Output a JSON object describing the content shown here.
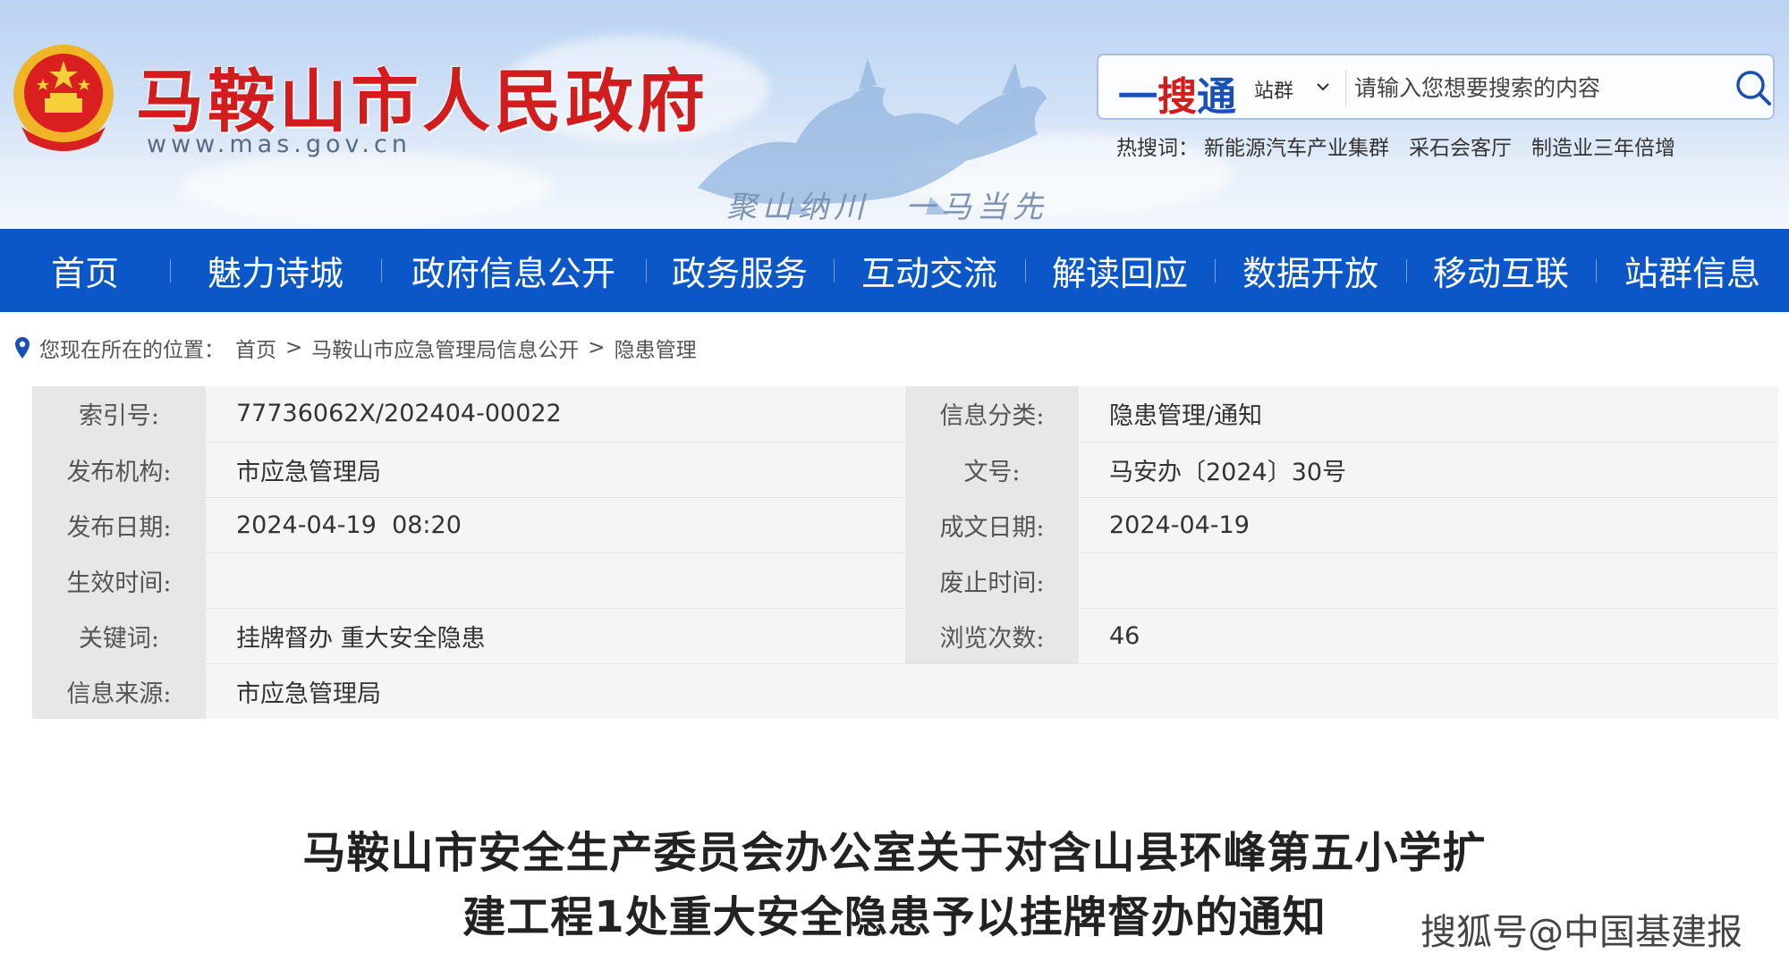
{
  "header": {
    "site_title": "马鞍山市人民政府",
    "site_url": "www.mas.gov.cn",
    "slogan": "聚山纳川　一马当先"
  },
  "search": {
    "brand_1": "一",
    "brand_2": "搜",
    "brand_3": "通",
    "scope": "站群",
    "placeholder": "请输入您想要搜索的内容",
    "hot_label": "热搜词：",
    "hot_words": [
      "新能源汽车产业集群",
      "采石会客厅",
      "制造业三年倍增"
    ]
  },
  "nav": [
    "首页",
    "魅力诗城",
    "政府信息公开",
    "政务服务",
    "互动交流",
    "解读回应",
    "数据开放",
    "移动互联",
    "站群信息"
  ],
  "breadcrumb": {
    "label": "您现在所在的位置：",
    "items": [
      "首页",
      "马鞍山市应急管理局信息公开",
      "隐患管理"
    ],
    "separator": ">"
  },
  "info": {
    "index_label": "索引号:",
    "index_value": "77736062X/202404-00022",
    "category_label": "信息分类:",
    "category_value": "隐患管理/通知",
    "publisher_label": "发布机构:",
    "publisher_value": "市应急管理局",
    "doc_no_label": "文号:",
    "doc_no_value": "马安办〔2024〕30号",
    "pub_date_label": "发布日期:",
    "pub_date_value": "2024-04-19  08:20",
    "doc_date_label": "成文日期:",
    "doc_date_value": "2024-04-19",
    "effective_label": "生效时间:",
    "effective_value": "",
    "expire_label": "废止时间:",
    "expire_value": "",
    "keywords_label": "关键词:",
    "keywords_value": "挂牌督办 重大安全隐患",
    "views_label": "浏览次数:",
    "views_value": "46",
    "source_label": "信息来源:",
    "source_value": "市应急管理局"
  },
  "article": {
    "title_line1": "马鞍山市安全生产委员会办公室关于对含山县环峰第五小学扩",
    "title_line2": "建工程1处重大安全隐患予以挂牌督办的通知"
  },
  "watermark": "搜狐号@中国基建报",
  "colors": {
    "nav_bg": "#0c57c8",
    "title_red": "#d11d1d",
    "brand_blue": "#1a4fb8"
  }
}
